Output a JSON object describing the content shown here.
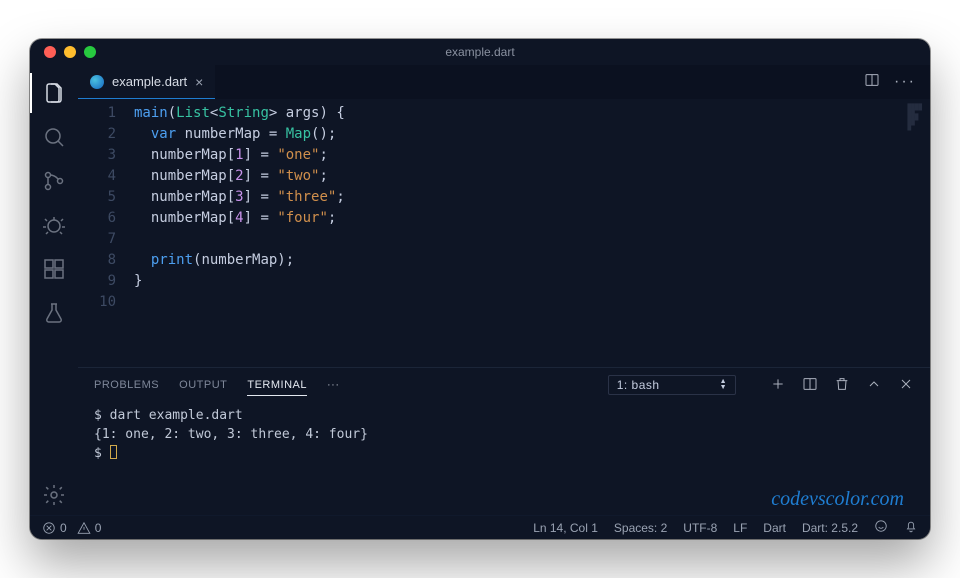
{
  "window": {
    "title": "example.dart"
  },
  "tab": {
    "filename": "example.dart"
  },
  "code": {
    "lines": [
      {
        "n": 1,
        "html": "<span class='fn'>main</span>(<span class='type'>List</span>&lt;<span class='type'>String</span>&gt; args) {"
      },
      {
        "n": 2,
        "html": "  <span class='kw'>var</span> numberMap = <span class='type'>Map</span>();"
      },
      {
        "n": 3,
        "html": "  numberMap[<span class='num'>1</span>] = <span class='str'>\"one\"</span>;"
      },
      {
        "n": 4,
        "html": "  numberMap[<span class='num'>2</span>] = <span class='str'>\"two\"</span>;"
      },
      {
        "n": 5,
        "html": "  numberMap[<span class='num'>3</span>] = <span class='str'>\"three\"</span>;"
      },
      {
        "n": 6,
        "html": "  numberMap[<span class='num'>4</span>] = <span class='str'>\"four\"</span>;"
      },
      {
        "n": 7,
        "html": ""
      },
      {
        "n": 8,
        "html": "  <span class='fn'>print</span>(numberMap);"
      },
      {
        "n": 9,
        "html": "}"
      },
      {
        "n": 10,
        "html": ""
      }
    ]
  },
  "panel": {
    "tabs": {
      "problems": "PROBLEMS",
      "output": "OUTPUT",
      "terminal": "TERMINAL"
    },
    "terminal_selector": "1: bash",
    "terminal_lines": [
      "$ dart example.dart",
      "{1: one, 2: two, 3: three, 4: four}"
    ],
    "prompt": "$ "
  },
  "status": {
    "errors": "0",
    "warnings": "0",
    "cursor": "Ln 14, Col 1",
    "spaces": "Spaces: 2",
    "encoding": "UTF-8",
    "eol": "LF",
    "lang": "Dart",
    "sdk": "Dart: 2.5.2"
  },
  "watermark": "codevscolor.com"
}
